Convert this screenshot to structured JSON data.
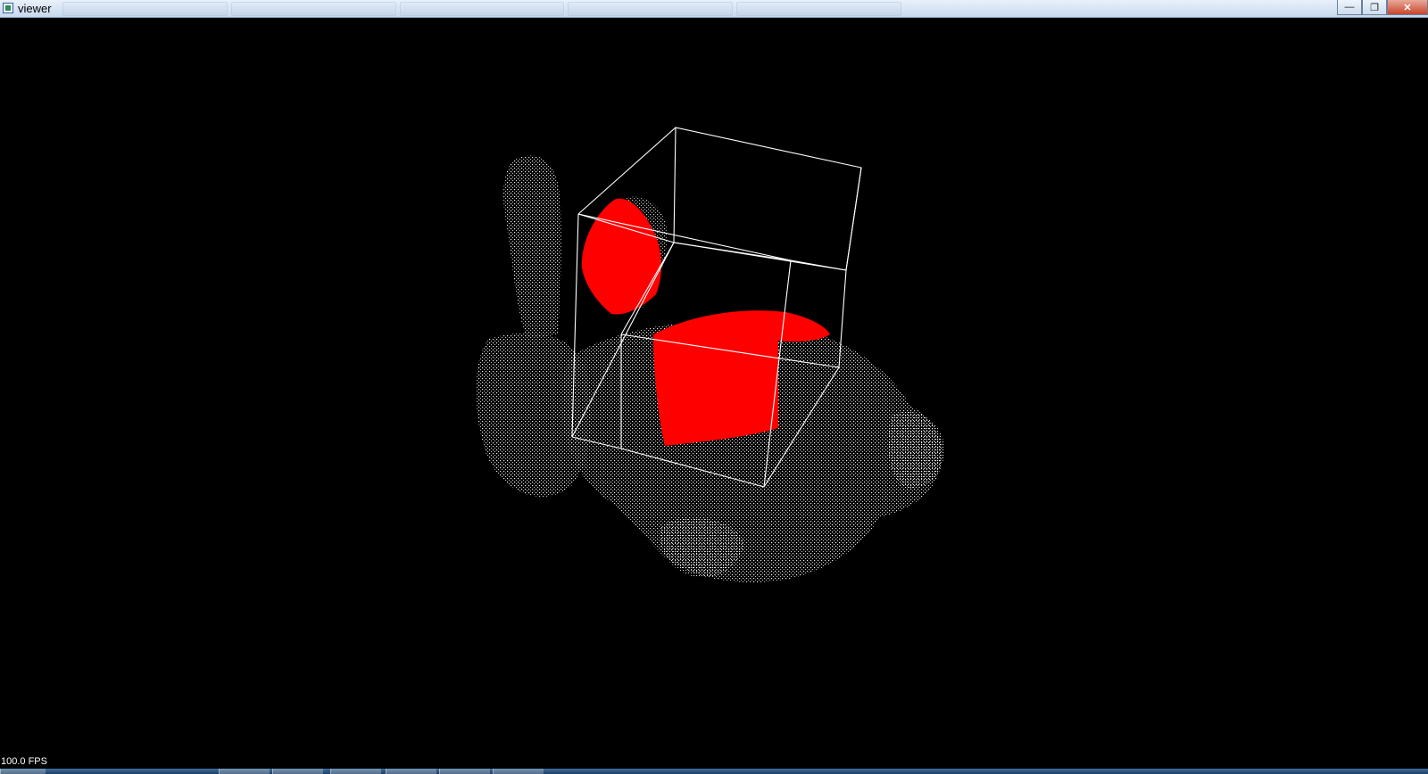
{
  "window": {
    "title": "viewer",
    "minimize_glyph": "—",
    "restore_glyph": "❐",
    "close_glyph": "✕"
  },
  "scene": {
    "point_color": "#ffffff",
    "highlight_color": "#ff0000",
    "box_color": "#ffffff",
    "background": "#000000",
    "object": "bunny point cloud",
    "highlighted_regions": 2
  },
  "status": {
    "fps": "100.0 FPS"
  }
}
